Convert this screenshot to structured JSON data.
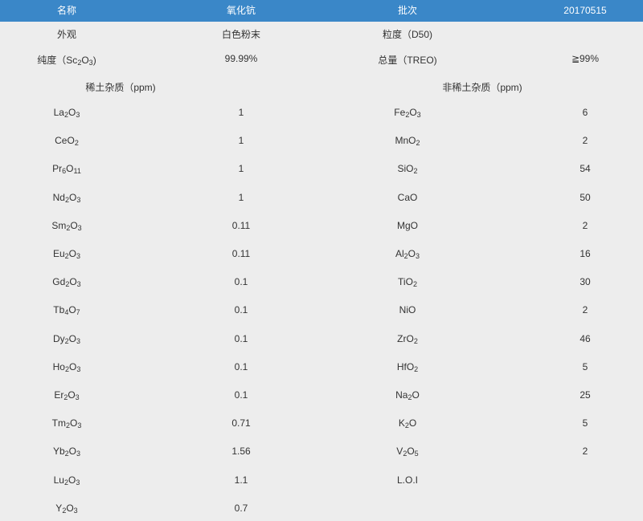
{
  "header": {
    "col1": "名称",
    "col2": "氧化钪",
    "col3": "批次",
    "col4": "20170515"
  },
  "info": [
    {
      "label": "外观",
      "value": "白色粉末",
      "label2": "粒度（D50)",
      "value2": ""
    },
    {
      "label": "纯度（Sc₂O₃)",
      "value": "99.99%",
      "label2": "总量（TREO)",
      "value2": "≧99%"
    }
  ],
  "sections": {
    "rare_earth": "稀土杂质（ppm)",
    "non_rare_earth": "非稀土杂质（ppm)"
  },
  "rows": [
    {
      "re": "La₂O₃",
      "re_val": "1",
      "nre": "Fe₂O₃",
      "nre_val": "6"
    },
    {
      "re": "CeO₂",
      "re_val": "1",
      "nre": "MnO₂",
      "nre_val": "2"
    },
    {
      "re": "Pr₆O₁₁",
      "re_val": "1",
      "nre": "SiO₂",
      "nre_val": "54"
    },
    {
      "re": "Nd₂O₃",
      "re_val": "1",
      "nre": "CaO",
      "nre_val": "50"
    },
    {
      "re": "Sm₂O₃",
      "re_val": "0.11",
      "nre": "MgO",
      "nre_val": "2"
    },
    {
      "re": "Eu₂O₃",
      "re_val": "0.11",
      "nre": "Al₂O₃",
      "nre_val": "16"
    },
    {
      "re": "Gd₂O₃",
      "re_val": "0.1",
      "nre": "TiO₂",
      "nre_val": "30"
    },
    {
      "re": "Tb₄O₇",
      "re_val": "0.1",
      "nre": "NiO",
      "nre_val": "2"
    },
    {
      "re": "Dy₂O₃",
      "re_val": "0.1",
      "nre": "ZrO₂",
      "nre_val": "46"
    },
    {
      "re": "Ho₂O₃",
      "re_val": "0.1",
      "nre": "HfO₂",
      "nre_val": "5"
    },
    {
      "re": "Er₂O₃",
      "re_val": "0.1",
      "nre": "Na₂O",
      "nre_val": "25"
    },
    {
      "re": "Tm₂O₃",
      "re_val": "0.71",
      "nre": "K₂O",
      "nre_val": "5"
    },
    {
      "re": "Yb₂O₃",
      "re_val": "1.56",
      "nre": "V₂O₅",
      "nre_val": "2"
    },
    {
      "re": "Lu₂O₃",
      "re_val": "1.1",
      "nre": "L.O.I",
      "nre_val": ""
    },
    {
      "re": "Y₂O₃",
      "re_val": "0.7",
      "nre": "",
      "nre_val": ""
    }
  ]
}
